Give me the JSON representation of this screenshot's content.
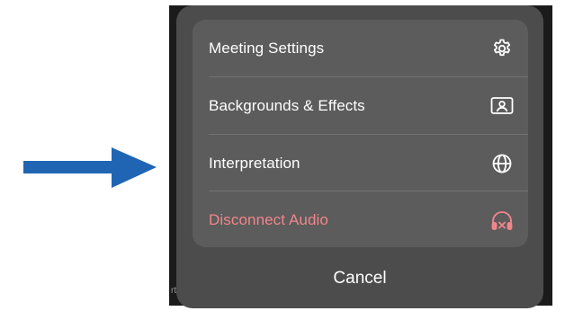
{
  "menu": {
    "items": [
      {
        "label": "Meeting Settings",
        "icon": "gear-icon"
      },
      {
        "label": "Backgrounds & Effects",
        "icon": "background-portrait-icon"
      },
      {
        "label": "Interpretation",
        "icon": "globe-icon"
      },
      {
        "label": "Disconnect Audio",
        "icon": "headphones-disconnect-icon"
      }
    ]
  },
  "cancel_label": "Cancel",
  "backdrop_snippet": "rt",
  "colors": {
    "arrow": "#1f65b3",
    "sheet_bg": "#4c4c4c",
    "card_bg": "#5c5c5c",
    "danger": "#f0868a",
    "text": "#ffffff"
  }
}
